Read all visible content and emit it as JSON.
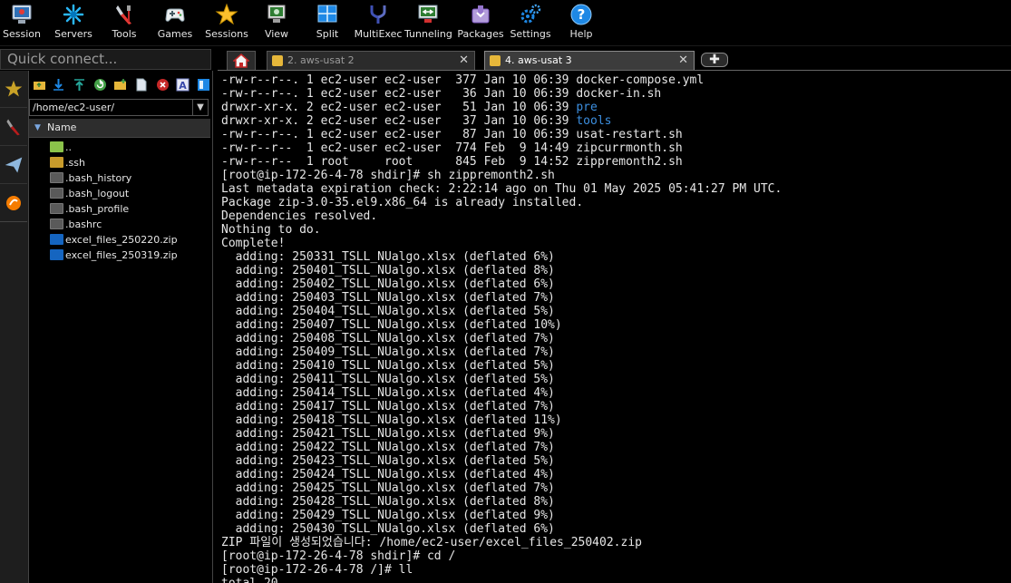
{
  "toolbar": {
    "items": [
      {
        "label": "Session",
        "icon": "session-icon"
      },
      {
        "label": "Servers",
        "icon": "servers-icon"
      },
      {
        "label": "Tools",
        "icon": "tools-icon"
      },
      {
        "label": "Games",
        "icon": "games-icon"
      },
      {
        "label": "Sessions",
        "icon": "sessions-star-icon"
      },
      {
        "label": "View",
        "icon": "view-icon"
      },
      {
        "label": "Split",
        "icon": "split-icon"
      },
      {
        "label": "MultiExec",
        "icon": "multiexec-icon"
      },
      {
        "label": "Tunneling",
        "icon": "tunneling-icon"
      },
      {
        "label": "Packages",
        "icon": "packages-icon"
      },
      {
        "label": "Settings",
        "icon": "settings-icon"
      },
      {
        "label": "Help",
        "icon": "help-icon"
      }
    ]
  },
  "quick_connect": {
    "placeholder": "Quick connect..."
  },
  "tabs": [
    {
      "label": "2. aws-usat 2",
      "active": false
    },
    {
      "label": "4. aws-usat 3",
      "active": true
    }
  ],
  "sftp": {
    "path": "/home/ec2-user/",
    "column_header": "Name",
    "files": [
      {
        "name": "..",
        "type": "up"
      },
      {
        "name": ".ssh",
        "type": "folder"
      },
      {
        "name": ".bash_history",
        "type": "file"
      },
      {
        "name": ".bash_logout",
        "type": "file"
      },
      {
        "name": ".bash_profile",
        "type": "file"
      },
      {
        "name": ".bashrc",
        "type": "file"
      },
      {
        "name": "excel_files_250220.zip",
        "type": "zip"
      },
      {
        "name": "excel_files_250319.zip",
        "type": "zip"
      }
    ]
  },
  "terminal": {
    "lines": [
      {
        "text": "-rw-r--r--. 1 ec2-user ec2-user  377 Jan 10 06:39 docker-compose.yml"
      },
      {
        "text": "-rw-r--r--. 1 ec2-user ec2-user   36 Jan 10 06:39 docker-in.sh"
      },
      {
        "text": "drwxr-xr-x. 2 ec2-user ec2-user   51 Jan 10 06:39 ",
        "dir": "pre"
      },
      {
        "text": "drwxr-xr-x. 2 ec2-user ec2-user   37 Jan 10 06:39 ",
        "dir": "tools"
      },
      {
        "text": "-rw-r--r--. 1 ec2-user ec2-user   87 Jan 10 06:39 usat-restart.sh"
      },
      {
        "text": "-rw-r--r--  1 ec2-user ec2-user  774 Feb  9 14:49 zipcurrmonth.sh"
      },
      {
        "text": "-rw-r--r--  1 root     root      845 Feb  9 14:52 zippremonth2.sh"
      },
      {
        "text": "[root@ip-172-26-4-78 shdir]# sh zippremonth2.sh"
      },
      {
        "text": "Last metadata expiration check: 2:22:14 ago on Thu 01 May 2025 05:41:27 PM UTC."
      },
      {
        "text": "Package zip-3.0-35.el9.x86_64 is already installed."
      },
      {
        "text": "Dependencies resolved."
      },
      {
        "text": "Nothing to do."
      },
      {
        "text": "Complete!"
      },
      {
        "text": "  adding: 250331_TSLL_NUalgo.xlsx (deflated 6%)"
      },
      {
        "text": "  adding: 250401_TSLL_NUalgo.xlsx (deflated 8%)"
      },
      {
        "text": "  adding: 250402_TSLL_NUalgo.xlsx (deflated 6%)"
      },
      {
        "text": "  adding: 250403_TSLL_NUalgo.xlsx (deflated 7%)"
      },
      {
        "text": "  adding: 250404_TSLL_NUalgo.xlsx (deflated 5%)"
      },
      {
        "text": "  adding: 250407_TSLL_NUalgo.xlsx (deflated 10%)"
      },
      {
        "text": "  adding: 250408_TSLL_NUalgo.xlsx (deflated 7%)"
      },
      {
        "text": "  adding: 250409_TSLL_NUalgo.xlsx (deflated 7%)"
      },
      {
        "text": "  adding: 250410_TSLL_NUalgo.xlsx (deflated 5%)"
      },
      {
        "text": "  adding: 250411_TSLL_NUalgo.xlsx (deflated 5%)"
      },
      {
        "text": "  adding: 250414_TSLL_NUalgo.xlsx (deflated 4%)"
      },
      {
        "text": "  adding: 250417_TSLL_NUalgo.xlsx (deflated 7%)"
      },
      {
        "text": "  adding: 250418_TSLL_NUalgo.xlsx (deflated 11%)"
      },
      {
        "text": "  adding: 250421_TSLL_NUalgo.xlsx (deflated 9%)"
      },
      {
        "text": "  adding: 250422_TSLL_NUalgo.xlsx (deflated 7%)"
      },
      {
        "text": "  adding: 250423_TSLL_NUalgo.xlsx (deflated 5%)"
      },
      {
        "text": "  adding: 250424_TSLL_NUalgo.xlsx (deflated 4%)"
      },
      {
        "text": "  adding: 250425_TSLL_NUalgo.xlsx (deflated 7%)"
      },
      {
        "text": "  adding: 250428_TSLL_NUalgo.xlsx (deflated 8%)"
      },
      {
        "text": "  adding: 250429_TSLL_NUalgo.xlsx (deflated 9%)"
      },
      {
        "text": "  adding: 250430_TSLL_NUalgo.xlsx (deflated 6%)"
      },
      {
        "text": "ZIP 파일이 생성되었습니다: /home/ec2-user/excel_files_250402.zip"
      },
      {
        "text": "[root@ip-172-26-4-78 shdir]# cd /"
      },
      {
        "text": "[root@ip-172-26-4-78 /]# ll"
      },
      {
        "text": "total 20"
      }
    ]
  }
}
